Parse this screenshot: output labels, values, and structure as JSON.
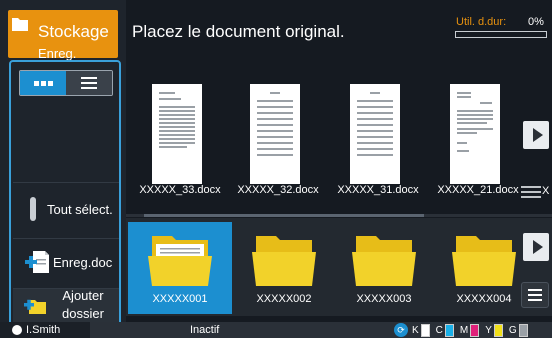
{
  "mode": {
    "title": "Stockage",
    "subtitle": "Enreg.",
    "accent": "#e8920f"
  },
  "header": {
    "instruction": "Placez le document original.",
    "usage_label": "Util. d.dur:",
    "usage_percent": "0%"
  },
  "view_toggle": {
    "active": "thumbnails",
    "icons": [
      "thumbnail-view-icon",
      "list-view-icon"
    ]
  },
  "side": {
    "select_all": "Tout sélect.",
    "save_doc": "Enreg.doc",
    "add_folder_line1": "Ajouter",
    "add_folder_line2": "dossier"
  },
  "documents": [
    {
      "name": "XXXXX_33.docx"
    },
    {
      "name": "XXXXX_32.docx"
    },
    {
      "name": "XXXXX_31.docx"
    },
    {
      "name": "XXXXX_21.docx"
    }
  ],
  "documents_overflow_text": "X",
  "folders": [
    {
      "name": "XXXXX001",
      "selected": true
    },
    {
      "name": "XXXXX002",
      "selected": false
    },
    {
      "name": "XXXXX003",
      "selected": false
    },
    {
      "name": "XXXXX004",
      "selected": false
    }
  ],
  "status": {
    "user": "I.Smith",
    "state": "Inactif",
    "inks": [
      {
        "letter": "K",
        "color": "#ffffff"
      },
      {
        "letter": "C",
        "color": "#1ab0e8"
      },
      {
        "letter": "M",
        "color": "#e0207a"
      },
      {
        "letter": "Y",
        "color": "#f2e01a"
      },
      {
        "letter": "G",
        "color": "#9aa0a6"
      }
    ]
  },
  "colors": {
    "selection": "#1c8fd0",
    "folder": "#f2d22a",
    "background": "#151a21"
  }
}
